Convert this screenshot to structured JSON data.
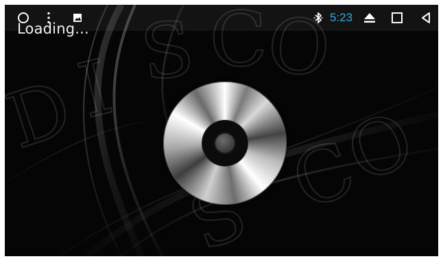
{
  "screen": {
    "loading_text": "Loading...",
    "watermark_text": "DISCO"
  },
  "status_bar": {
    "left_icons": [
      "circle-icon",
      "more-vert-icon",
      "image-icon"
    ],
    "bluetooth_icon": "bluetooth-icon",
    "time": "5:23",
    "nav_icons": [
      "eject-icon",
      "square-icon",
      "back-triangle-icon"
    ]
  },
  "colors": {
    "background": "#050505",
    "clock": "#35a9d8",
    "icons": "#ffffff",
    "disc_center": "#0b0b0b"
  }
}
